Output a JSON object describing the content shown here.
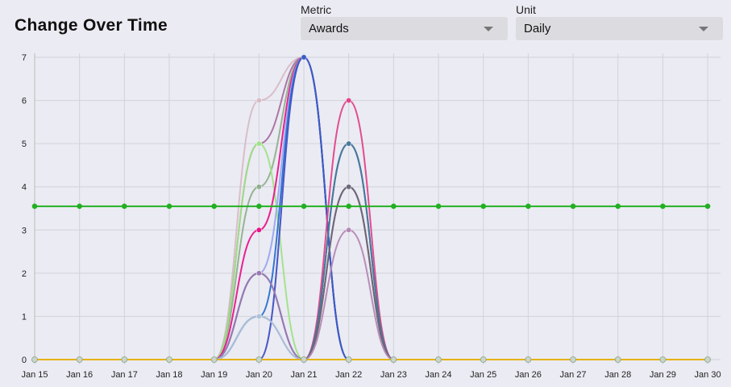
{
  "header": {
    "title": "Change Over Time"
  },
  "controls": {
    "metric": {
      "label": "Metric",
      "value": "Awards",
      "icon": "chevron-down-icon"
    },
    "unit": {
      "label": "Unit",
      "value": "Daily",
      "icon": "chevron-down-icon"
    }
  },
  "colors": {
    "background": "#ebebf3",
    "grid": "#d2d2da",
    "reference_line": "#22b022"
  },
  "chart_data": {
    "type": "line",
    "categories": [
      "Jan 15",
      "Jan 16",
      "Jan 17",
      "Jan 18",
      "Jan 19",
      "Jan 20",
      "Jan 21",
      "Jan 22",
      "Jan 23",
      "Jan 24",
      "Jan 25",
      "Jan 26",
      "Jan 27",
      "Jan 28",
      "Jan 29",
      "Jan 30"
    ],
    "ylim": [
      0,
      7
    ],
    "yticks": [
      0,
      1,
      2,
      3,
      4,
      5,
      6,
      7
    ],
    "grid": true,
    "reference_line": {
      "value": 3.55,
      "color": "#22b022"
    },
    "baseline_color": "#a8cfe8",
    "series": [
      {
        "color": "#d7bcc6",
        "values": [
          0,
          0,
          0,
          0,
          0,
          6,
          7,
          0,
          0,
          0,
          0,
          0,
          0,
          0,
          0,
          0
        ]
      },
      {
        "color": "#a8709e",
        "values": [
          0,
          0,
          0,
          0,
          0,
          5,
          7,
          0,
          0,
          0,
          0,
          0,
          0,
          0,
          0,
          0
        ]
      },
      {
        "color": "#8fb08c",
        "values": [
          0,
          0,
          0,
          0,
          0,
          4,
          7,
          0,
          0,
          0,
          0,
          0,
          0,
          0,
          0,
          0
        ]
      },
      {
        "color": "#9fe386",
        "values": [
          0,
          0,
          0,
          0,
          0,
          5,
          0,
          0,
          0,
          0,
          0,
          0,
          0,
          0,
          0,
          0
        ]
      },
      {
        "color": "#e9158a",
        "values": [
          0,
          0,
          0,
          0,
          0,
          3,
          7,
          0,
          0,
          0,
          0,
          0,
          0,
          0,
          0,
          0
        ]
      },
      {
        "color": "#9aa6ee",
        "values": [
          0,
          0,
          0,
          0,
          0,
          2,
          7,
          0,
          0,
          0,
          0,
          0,
          0,
          0,
          0,
          0
        ]
      },
      {
        "color": "#e86adf",
        "values": [
          0,
          0,
          0,
          0,
          0,
          0,
          7,
          0,
          0,
          0,
          0,
          0,
          0,
          0,
          0,
          0
        ]
      },
      {
        "color": "#2a6fd0",
        "values": [
          0,
          0,
          0,
          0,
          0,
          1,
          7,
          0,
          0,
          0,
          0,
          0,
          0,
          0,
          0,
          0
        ]
      },
      {
        "color": "#3a5bc4",
        "values": [
          0,
          0,
          0,
          0,
          0,
          0,
          7,
          0,
          0,
          0,
          0,
          0,
          0,
          0,
          0,
          0
        ]
      },
      {
        "color": "#5a5a96",
        "values": [
          0,
          0,
          0,
          0,
          0,
          2,
          0,
          0,
          0,
          0,
          0,
          0,
          0,
          0,
          0,
          0
        ]
      },
      {
        "color": "#9a7ab2",
        "values": [
          0,
          0,
          0,
          0,
          0,
          2,
          0,
          0,
          0,
          0,
          0,
          0,
          0,
          0,
          0,
          0
        ]
      },
      {
        "color": "#6a9ac8",
        "values": [
          0,
          0,
          0,
          0,
          0,
          1,
          0,
          0,
          0,
          0,
          0,
          0,
          0,
          0,
          0,
          0
        ]
      },
      {
        "color": "#b0c0d8",
        "values": [
          0,
          0,
          0,
          0,
          0,
          1,
          0,
          0,
          0,
          0,
          0,
          0,
          0,
          0,
          0,
          0
        ]
      },
      {
        "color": "#e0458a",
        "values": [
          0,
          0,
          0,
          0,
          0,
          0,
          0,
          6,
          0,
          0,
          0,
          0,
          0,
          0,
          0,
          0
        ]
      },
      {
        "color": "#2c5f8c",
        "values": [
          0,
          0,
          0,
          0,
          0,
          0,
          0,
          5,
          0,
          0,
          0,
          0,
          0,
          0,
          0,
          0
        ]
      },
      {
        "color": "#4a7a9c",
        "values": [
          0,
          0,
          0,
          0,
          0,
          0,
          0,
          5,
          0,
          0,
          0,
          0,
          0,
          0,
          0,
          0
        ]
      },
      {
        "color": "#8a3a5c",
        "values": [
          0,
          0,
          0,
          0,
          0,
          0,
          0,
          4,
          0,
          0,
          0,
          0,
          0,
          0,
          0,
          0
        ]
      },
      {
        "color": "#6a6a7a",
        "values": [
          0,
          0,
          0,
          0,
          0,
          0,
          0,
          4,
          0,
          0,
          0,
          0,
          0,
          0,
          0,
          0
        ]
      },
      {
        "color": "#b488b4",
        "values": [
          0,
          0,
          0,
          0,
          0,
          0,
          0,
          3,
          0,
          0,
          0,
          0,
          0,
          0,
          0,
          0
        ]
      },
      {
        "color": "#e8b400",
        "values": [
          0,
          0,
          0,
          0,
          0,
          0,
          0,
          0,
          0,
          0,
          0,
          0,
          0,
          0,
          0,
          0
        ]
      }
    ]
  }
}
